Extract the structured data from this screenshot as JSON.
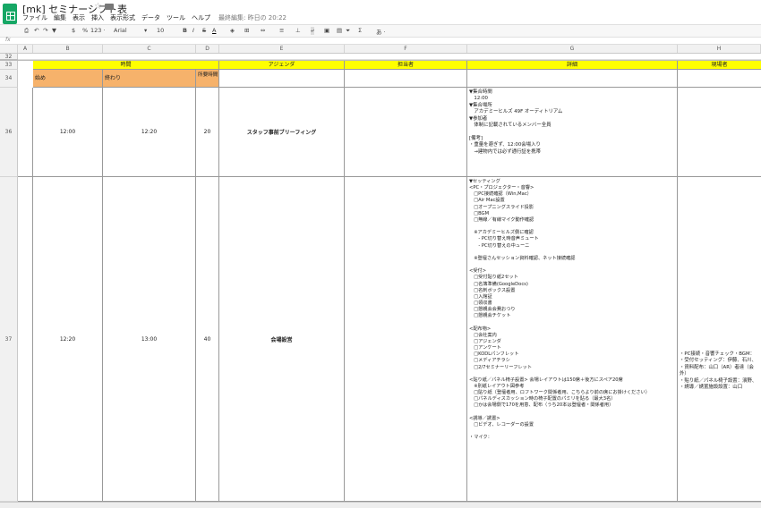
{
  "app": {
    "doc_title": "[mk] セミナーシフト表",
    "star_icon": "star-icon",
    "folder_icon": "folder-icon"
  },
  "menu": {
    "items": [
      "ファイル",
      "編集",
      "表示",
      "挿入",
      "表示形式",
      "データ",
      "ツール",
      "ヘルプ"
    ],
    "last_edit": "最終編集: 昨日の 20:22"
  },
  "toolbar": {
    "currency": "$",
    "percent": "%",
    "number_format": "123 ·",
    "font": "Arial",
    "font_size": "10",
    "bold": "B",
    "italic": "I",
    "strike": "S",
    "text_color": "A",
    "font_dropdown_chevron": "▾",
    "more_label": "あ ·"
  },
  "formula_bar": {
    "fx": "fx"
  },
  "columns": [
    "A",
    "B",
    "C",
    "D",
    "E",
    "F",
    "G",
    "H"
  ],
  "rows": {
    "r32": "32",
    "r33": "33",
    "r34": "34",
    "r36": "36",
    "r37": "37"
  },
  "header33": {
    "time": "時間",
    "agenda": "アジェンダ",
    "owner": "担当者",
    "detail": "詳細",
    "staff": "現場者"
  },
  "header34": {
    "start": "始め",
    "end": "終わり",
    "duration": "所要時間"
  },
  "row36": {
    "start": "12:00",
    "end": "12:20",
    "duration": "20",
    "agenda": "スタッフ事前ブリーフィング",
    "detail": "▼集合時間\n　12:00\n▼集合場所\n　アカデミーヒルズ 49F オーディトリアム\n▼参加者\n　体制に記載されているメンバー全員\n\n[備考]\n・重量を避ぎず、12:00会場入り\n　→建物内では必ず通行証を携帯"
  },
  "row37": {
    "start": "12:20",
    "end": "13:00",
    "duration": "40",
    "agenda": "会場設営",
    "detail": "▼セッティング\n<PC・プロジェクター・音響>\n　□PC接続確認（Win,Mac）\n　□Air Mac設置\n　□オープニングスライド投影\n　□BGM\n　□無線／有線マイク動作確認\n\n　※アカデミーヒルズ側に確認\n　　- PC切り替え時音声ミュート\n　　- PC切り替えの中ューニ\n\n　※登壇さんセッション資料確認、ネット接続確認\n\n<受付>\n　□受付貼り紙2セット\n　□名簿準備(GoogleDocs)\n　□名刺ボックス設置\n　□入館証\n　□領収書\n　□懇親会会費おつり\n　□懇親会チケット\n\n<配布物>\n　□会社案内\n　□アジェンダ\n　□アンケート\n　□KODLパンフレット\n　□メディアチラシ\n　□2/7セミナーリーフレット\n\n<貼り紙／パネル椅子設置> 会場レイアウトは150席＋後方にスペア20席\n　※別紙レイアウト図参考\n　□貼り紙（登壇者用、ロフトワーク関係者用、こちらより前の席にお掛けください）\n　□パネルディスカッション時の椅子配置のパミリを貼る（最大3名）\n　□かは会場側で170を用意、配布（うち20本は登壇者・関係者用）\n\n<誘導／誘置>\n　□ビデオ、レコーダーの設置\n\n・マイク：",
    "staff": "・PC接続・音響チェック・BGM：\n・受付セッティング：伊藤、石川、\n・資料配布：山口（AR）者達（会\n外）\n・貼り紙／パネル椅子設置：濱野、\n・誘導／誘置施設設置：山口"
  }
}
